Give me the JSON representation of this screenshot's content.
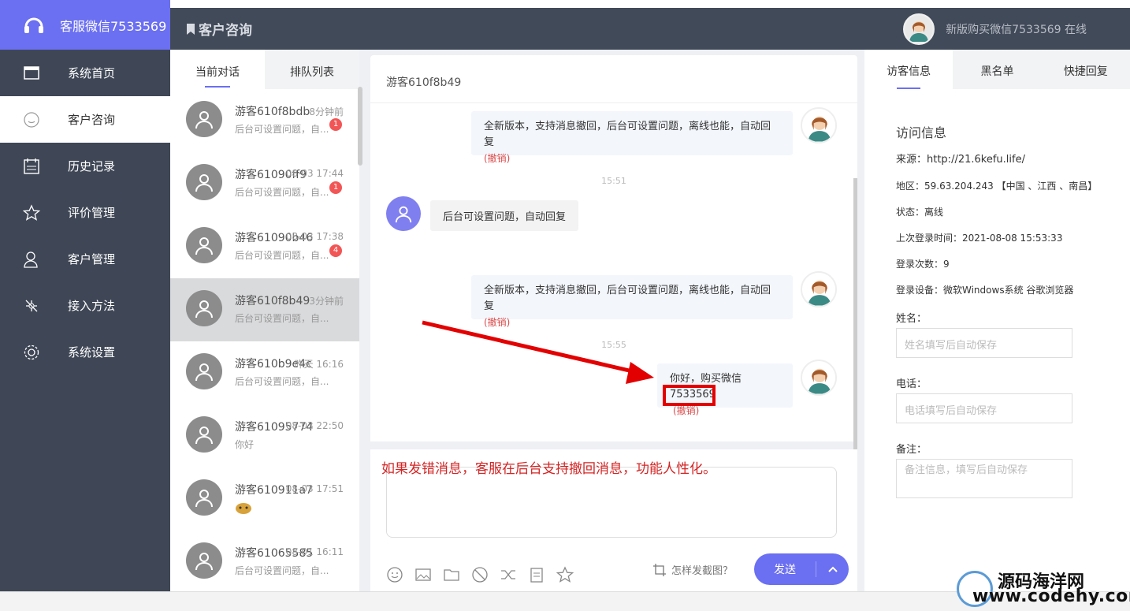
{
  "brand": {
    "title": "客服微信7533569"
  },
  "menu": [
    {
      "label": "系统首页",
      "icon": "monitor-icon"
    },
    {
      "label": "客户咨询",
      "icon": "chat-bubble-icon"
    },
    {
      "label": "历史记录",
      "icon": "calendar-icon"
    },
    {
      "label": "评价管理",
      "icon": "star-icon"
    },
    {
      "label": "客户管理",
      "icon": "user-icon"
    },
    {
      "label": "接入方法",
      "icon": "connect-icon"
    },
    {
      "label": "系统设置",
      "icon": "gear-icon"
    }
  ],
  "topbar": {
    "title": "客户咨询",
    "user_status": "新版购买微信7533569 在线"
  },
  "conv_tabs": {
    "current": "当前对话",
    "queue": "排队列表"
  },
  "conversations": [
    {
      "name": "游客610f8bdb",
      "time": "8分钟前",
      "preview": "后台可设置问题，自...",
      "badge": "1"
    },
    {
      "name": "游客61090ff9",
      "time": "08-03 17:44",
      "preview": "后台可设置问题，自...",
      "badge": "1"
    },
    {
      "name": "游客61090b46",
      "time": "08-03 17:38",
      "preview": "后台可设置问题，自...",
      "badge": "4"
    },
    {
      "name": "游客610f8b49",
      "time": "3分钟前",
      "preview": "后台可设置问题，自...",
      "badge": ""
    },
    {
      "name": "游客610b9e4c",
      "time": "昨天 16:16",
      "preview": "后台可设置问题，自...",
      "badge": ""
    },
    {
      "name": "游客61095774",
      "time": "08-03 22:50",
      "preview": "你好",
      "badge": ""
    },
    {
      "name": "游客610911a7",
      "time": "08-03 17:51",
      "preview": "",
      "badge": ""
    },
    {
      "name": "游客61065585",
      "time": "08-01 16:11",
      "preview": "后台可设置问题，自...",
      "badge": ""
    }
  ],
  "chat": {
    "visitor": "游客610f8b49",
    "msg1": "全新版本，支持消息撤回，后台可设置问题，离线也能，自动回复",
    "revoke": "(撤销)",
    "time1": "15:51",
    "msg_visitor": "后台可设置问题，自动回复",
    "msg2": "全新版本，支持消息撤回，后台可设置问题，离线也能，自动回复",
    "time2": "15:55",
    "msg3": "你好，购买微信7533569"
  },
  "annotation": "如果发错消息，客服在后台支持撤回消息，功能人性化。",
  "composer": {
    "howto": "怎样发截图？",
    "send": "发送"
  },
  "right_tabs": {
    "info": "访客信息",
    "blacklist": "黑名单",
    "quick": "快捷回复"
  },
  "visit_info": {
    "title": "访问信息",
    "source": "来源：http://21.6kefu.life/",
    "region": "地区：59.63.204.243 【中国 、江西 、南昌】",
    "state": "状态：离线",
    "last_login": "上次登录时间：2021-08-08 15:53:33",
    "login_count": "登录次数：9",
    "device": "登录设备：微软Windows系统 谷歌浏览器",
    "name_label": "姓名：",
    "name_placeholder": "姓名填写后自动保存",
    "phone_label": "电话：",
    "phone_placeholder": "电话填写后自动保存",
    "note_label": "备注：",
    "note_placeholder": "备注信息，填写后自动保存"
  },
  "watermark": {
    "line1": "源码海洋网",
    "line2": "www.codehy.com"
  }
}
